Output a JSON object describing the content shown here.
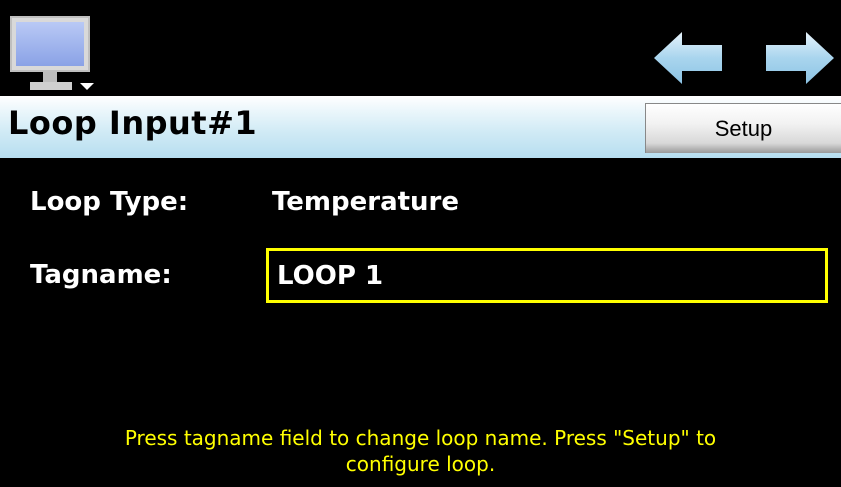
{
  "topbar": {
    "menu_icon": "monitor-icon",
    "back_icon": "arrow-left-icon",
    "forward_icon": "arrow-right-icon"
  },
  "header": {
    "title": "Loop Input#1",
    "setup_label": "Setup"
  },
  "fields": {
    "loop_type_label": "Loop Type:",
    "loop_type_value": "Temperature",
    "tagname_label": "Tagname:",
    "tagname_value": "LOOP 1"
  },
  "hint": {
    "line1": "Press tagname field to change loop name.  Press \"Setup\" to",
    "line2": "configure loop."
  },
  "colors": {
    "background": "#000000",
    "title_gradient_bottom": "#b7def0",
    "highlight": "#ffff00",
    "arrow_fill": "#a8d4ee"
  }
}
